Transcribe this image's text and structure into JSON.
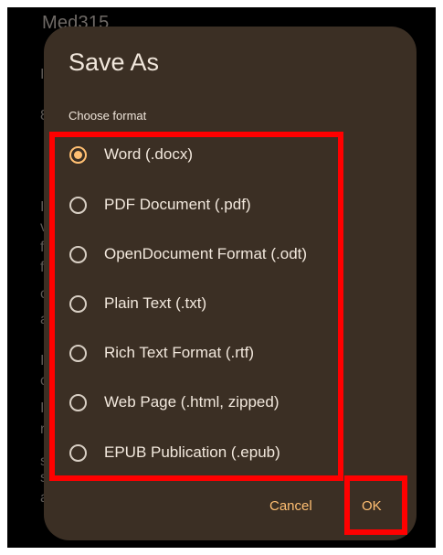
{
  "background": {
    "title": "Med315",
    "fragments": [
      "I",
      "8",
      "I",
      "v",
      "f",
      "f",
      "c",
      "a",
      "I",
      "c",
      "I",
      "r",
      "s",
      "s",
      "a"
    ]
  },
  "dialog": {
    "title": "Save As",
    "section_label": "Choose format",
    "options": [
      {
        "label": "Word (.docx)",
        "selected": true
      },
      {
        "label": "PDF Document (.pdf)",
        "selected": false
      },
      {
        "label": "OpenDocument Format (.odt)",
        "selected": false
      },
      {
        "label": "Plain Text (.txt)",
        "selected": false
      },
      {
        "label": "Rich Text Format (.rtf)",
        "selected": false
      },
      {
        "label": "Web Page (.html, zipped)",
        "selected": false
      },
      {
        "label": "EPUB Publication (.epub)",
        "selected": false
      }
    ],
    "cancel_label": "Cancel",
    "ok_label": "OK"
  },
  "colors": {
    "dialog_bg": "#3b2f24",
    "accent": "#ffbf72",
    "highlight": "#ff0000"
  }
}
